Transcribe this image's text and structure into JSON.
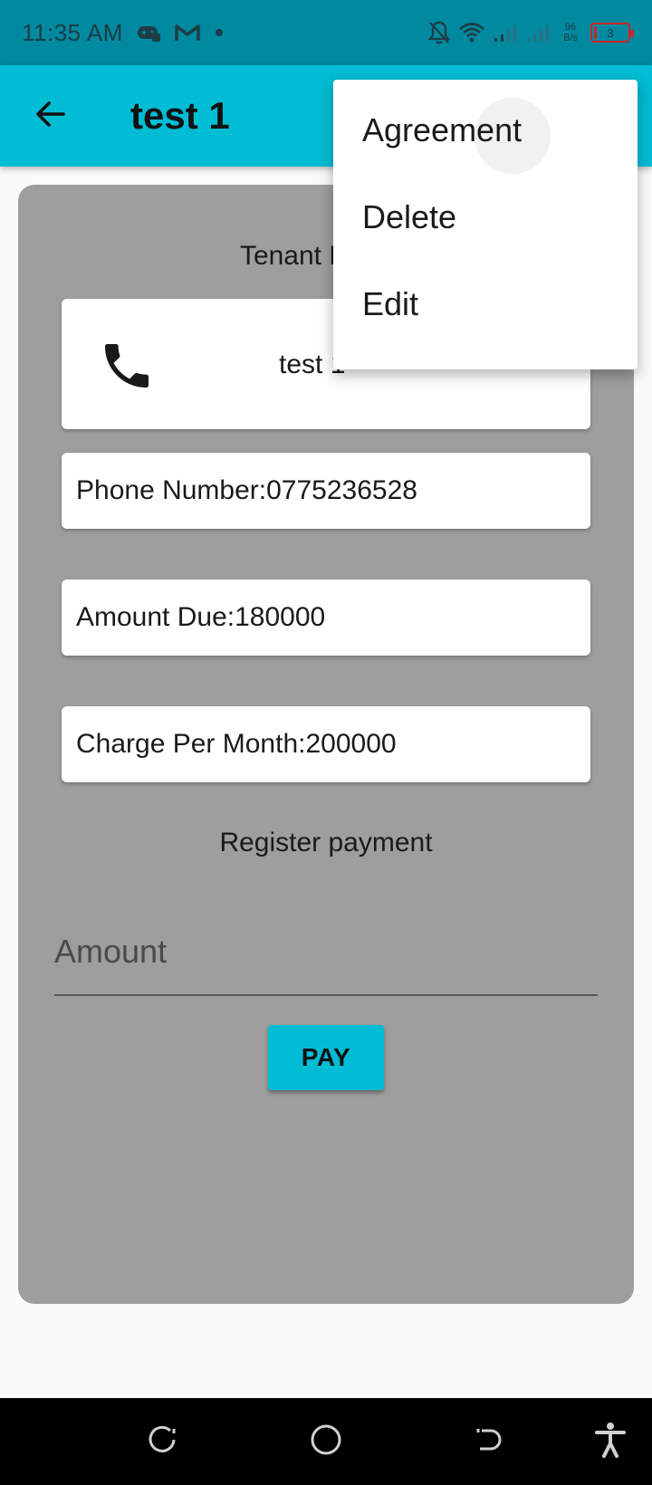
{
  "status_bar": {
    "time": "11:35 AM",
    "net_speed_value": "96",
    "net_speed_unit": "B/s",
    "battery_level": "3"
  },
  "app_bar": {
    "title": "test 1"
  },
  "tenant": {
    "section_title": "Tenant Details",
    "name": "test 1",
    "phone_text": "Phone Number:0775236528",
    "amount_due_text": "Amount Due:180000",
    "charge_per_month_text": "Charge Per Month:200000"
  },
  "payment": {
    "section_title": "Register payment",
    "amount_placeholder": "Amount",
    "pay_label": "PAY"
  },
  "menu": {
    "items": [
      {
        "label": "Agreement"
      },
      {
        "label": "Delete"
      },
      {
        "label": "Edit"
      }
    ]
  },
  "colors": {
    "status_bar": "#00899f",
    "app_bar": "#00bcd4",
    "card": "#9e9e9e",
    "button": "#00bcd4"
  }
}
